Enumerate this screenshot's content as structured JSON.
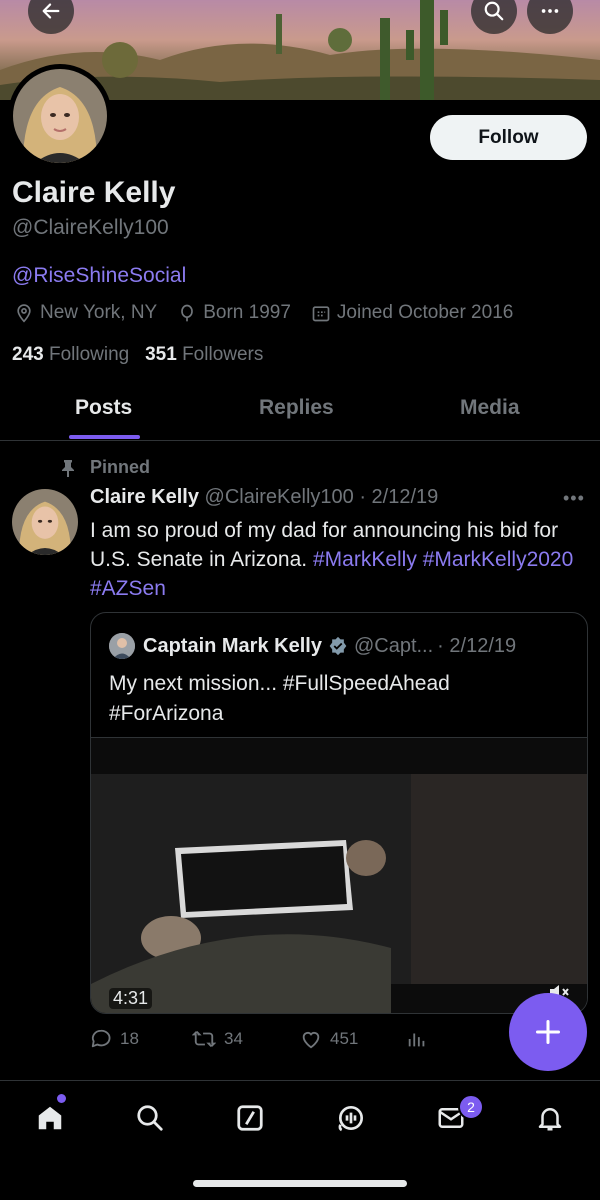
{
  "profile": {
    "name": "Claire Kelly",
    "handle": "@ClaireKelly100",
    "link": "@RiseShineSocial",
    "location": "New York, NY",
    "born": "Born 1997",
    "joined": "Joined October 2016",
    "following_count": "243",
    "following_label": "Following",
    "followers_count": "351",
    "followers_label": "Followers",
    "follow_label": "Follow"
  },
  "tabs": [
    {
      "label": "Posts",
      "active": true
    },
    {
      "label": "Replies",
      "active": false
    },
    {
      "label": "Media",
      "active": false
    }
  ],
  "post": {
    "pinned_label": "Pinned",
    "author": "Claire Kelly",
    "handle": "@ClaireKelly100",
    "date": "· 2/12/19",
    "text": "I am so proud of my dad for announcing his bid for U.S. Senate in Arizona.",
    "hashtags": [
      "#MarkKelly",
      "#MarkKelly2020",
      "#AZSen"
    ],
    "quote": {
      "author": "Captain Mark Kelly",
      "handle": "@Capt...",
      "date": "· 2/12/19",
      "line1": "My next mission... #FullSpeedAhead",
      "line2": "#ForArizona",
      "duration": "4:31"
    },
    "replies": "18",
    "reposts": "34",
    "likes": "451"
  },
  "nav": {
    "messages_badge": "2"
  },
  "colors": {
    "accent": "#7c5cf0",
    "link": "#8b7bf0",
    "background": "#000000"
  }
}
